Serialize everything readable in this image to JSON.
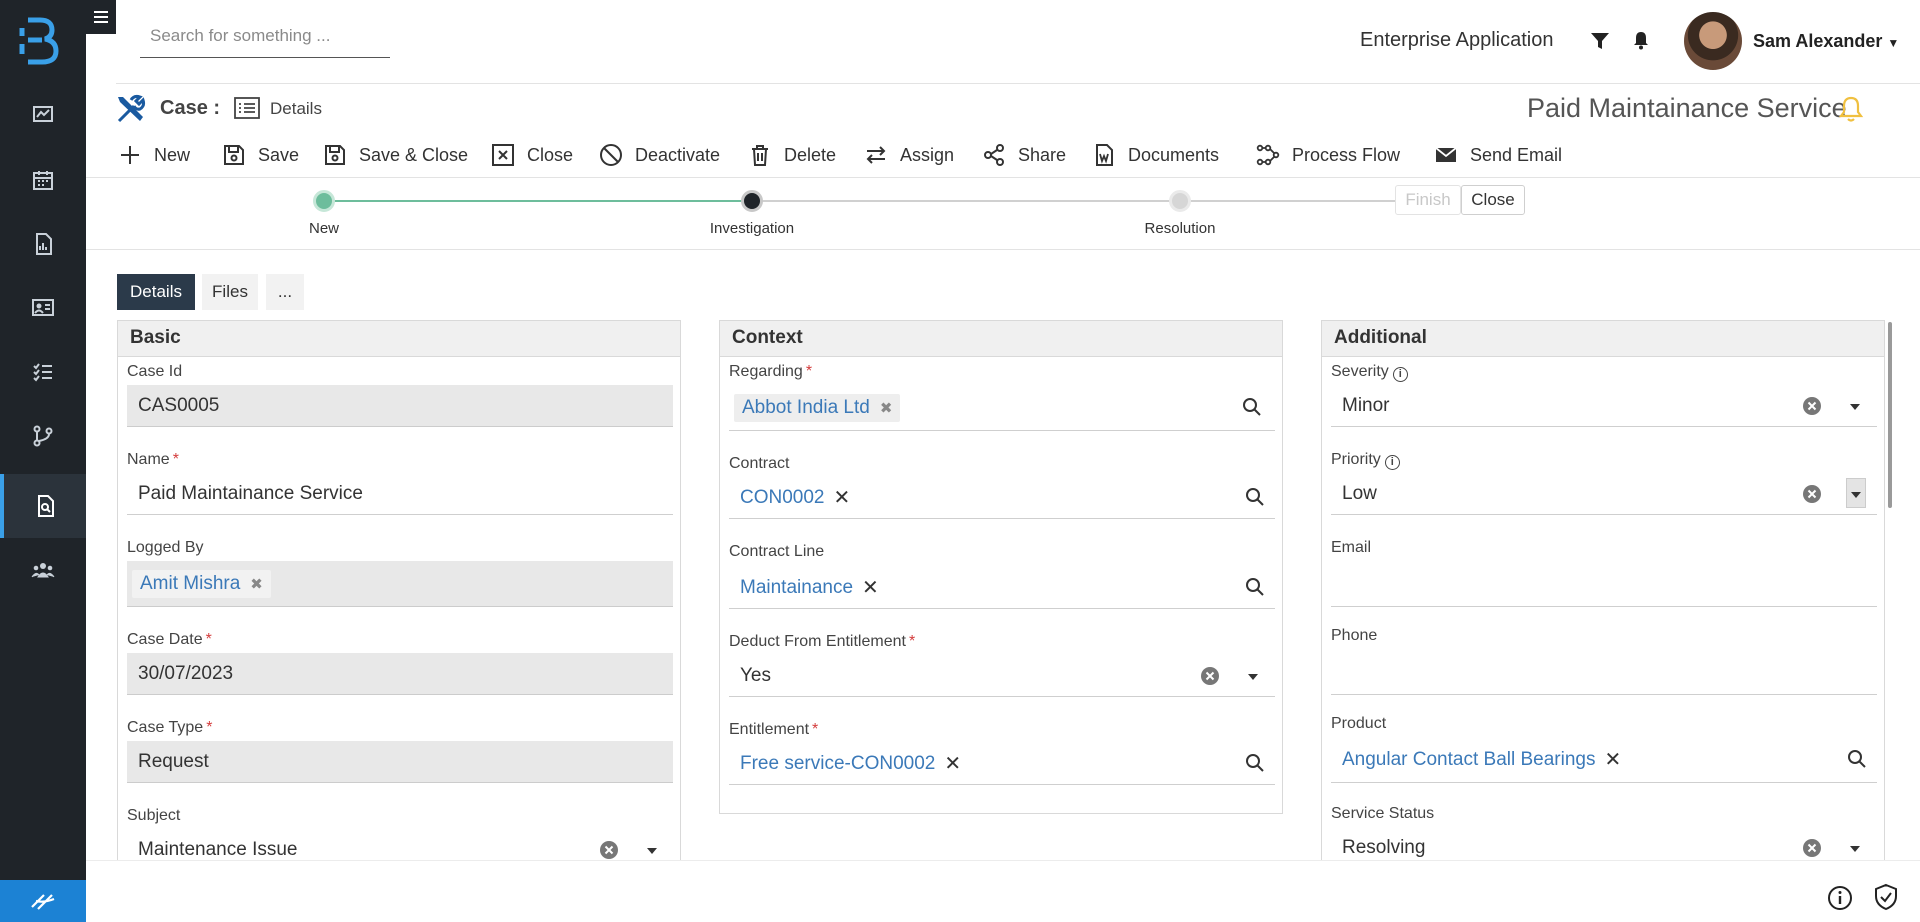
{
  "header": {
    "search_placeholder": "Search for something ...",
    "app_name": "Enterprise Application",
    "user_name": "Sam Alexander"
  },
  "titlebar": {
    "entity": "Case :",
    "view": "Details",
    "record_title": "Paid Maintainance Service"
  },
  "toolbar": {
    "new": "New",
    "save": "Save",
    "save_close": "Save & Close",
    "close": "Close",
    "deactivate": "Deactivate",
    "delete": "Delete",
    "assign": "Assign",
    "share": "Share",
    "documents": "Documents",
    "process_flow": "Process Flow",
    "send_email": "Send Email"
  },
  "process": {
    "stages": [
      "New",
      "Investigation",
      "Resolution"
    ],
    "finish": "Finish",
    "close": "Close"
  },
  "tabs": [
    "Details",
    "Files",
    "..."
  ],
  "basic": {
    "title": "Basic",
    "case_id_label": "Case Id",
    "case_id": "CAS0005",
    "name_label": "Name",
    "name": "Paid Maintainance Service",
    "logged_by_label": "Logged By",
    "logged_by": "Amit Mishra",
    "case_date_label": "Case Date",
    "case_date": "30/07/2023",
    "case_type_label": "Case Type",
    "case_type": "Request",
    "subject_label": "Subject",
    "subject": "Maintenance Issue"
  },
  "context": {
    "title": "Context",
    "regarding_label": "Regarding",
    "regarding": "Abbot India Ltd",
    "contract_label": "Contract",
    "contract": "CON0002",
    "contract_line_label": "Contract Line",
    "contract_line": "Maintainance",
    "deduct_label": "Deduct From Entitlement",
    "deduct": "Yes",
    "entitlement_label": "Entitlement",
    "entitlement": "Free service-CON0002"
  },
  "additional": {
    "title": "Additional",
    "severity_label": "Severity",
    "severity": "Minor",
    "priority_label": "Priority",
    "priority": "Low",
    "email_label": "Email",
    "email": "",
    "phone_label": "Phone",
    "phone": "",
    "product_label": "Product",
    "product": "Angular Contact Ball Bearings",
    "service_status_label": "Service Status",
    "service_status": "Resolving"
  },
  "colors": {
    "sidebar": "#1f2429",
    "accent": "#3b79b8",
    "stage_done": "#6dbd9c",
    "stage_current": "#1f2429",
    "active_tab": "#2b3a4a",
    "required": "#d43c3c",
    "alert": "#f0c040"
  }
}
